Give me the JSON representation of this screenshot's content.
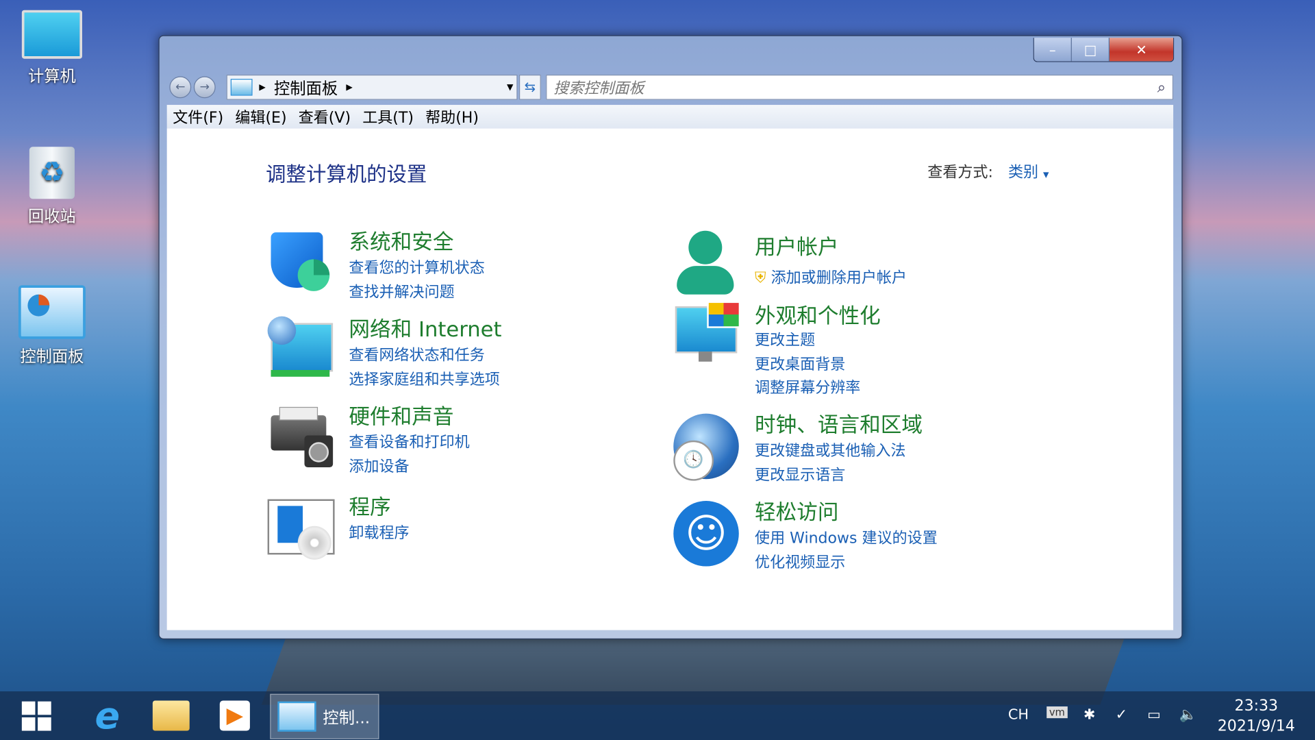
{
  "desktop": {
    "icons": [
      {
        "label": "计算机",
        "icon": "computer-icon"
      },
      {
        "label": "回收站",
        "icon": "recycle-bin-icon"
      },
      {
        "label": "控制面板",
        "icon": "control-panel-icon"
      }
    ]
  },
  "window": {
    "caption": {
      "minimize": "–",
      "maximize": "□",
      "close": "✕"
    },
    "address": {
      "crumb": "控制面板"
    },
    "search": {
      "placeholder": "搜索控制面板"
    },
    "menu": [
      "文件(F)",
      "编辑(E)",
      "查看(V)",
      "工具(T)",
      "帮助(H)"
    ],
    "heading": "调整计算机的设置",
    "view_by": {
      "label": "查看方式:",
      "value": "类别"
    },
    "categories": [
      {
        "title": "系统和安全",
        "links": [
          "查看您的计算机状态",
          "查找并解决问题"
        ],
        "icon": "shield-icon"
      },
      {
        "title": "网络和 Internet",
        "links": [
          "查看网络状态和任务",
          "选择家庭组和共享选项"
        ],
        "icon": "network-icon"
      },
      {
        "title": "硬件和声音",
        "links": [
          "查看设备和打印机",
          "添加设备"
        ],
        "icon": "printer-icon"
      },
      {
        "title": "程序",
        "links": [
          "卸载程序"
        ],
        "icon": "programs-icon"
      },
      {
        "title": "用户帐户",
        "links": [
          "添加或删除用户帐户"
        ],
        "icon": "user-icon"
      },
      {
        "title": "外观和个性化",
        "links": [
          "更改主题",
          "更改桌面背景",
          "调整屏幕分辨率"
        ],
        "icon": "monitor-icon"
      },
      {
        "title": "时钟、语言和区域",
        "links": [
          "更改键盘或其他输入法",
          "更改显示语言"
        ],
        "icon": "globe-clock-icon"
      },
      {
        "title": "轻松访问",
        "links": [
          "使用 Windows 建议的设置",
          "优化视频显示"
        ],
        "icon": "accessibility-icon"
      }
    ]
  },
  "taskbar": {
    "active_label": "控制...",
    "lang": "CH",
    "time": "23:33",
    "date": "2021/9/14"
  },
  "colors": {
    "category_title": "#1e7d2e",
    "link": "#1a5fb4",
    "heading": "#1e3287"
  }
}
